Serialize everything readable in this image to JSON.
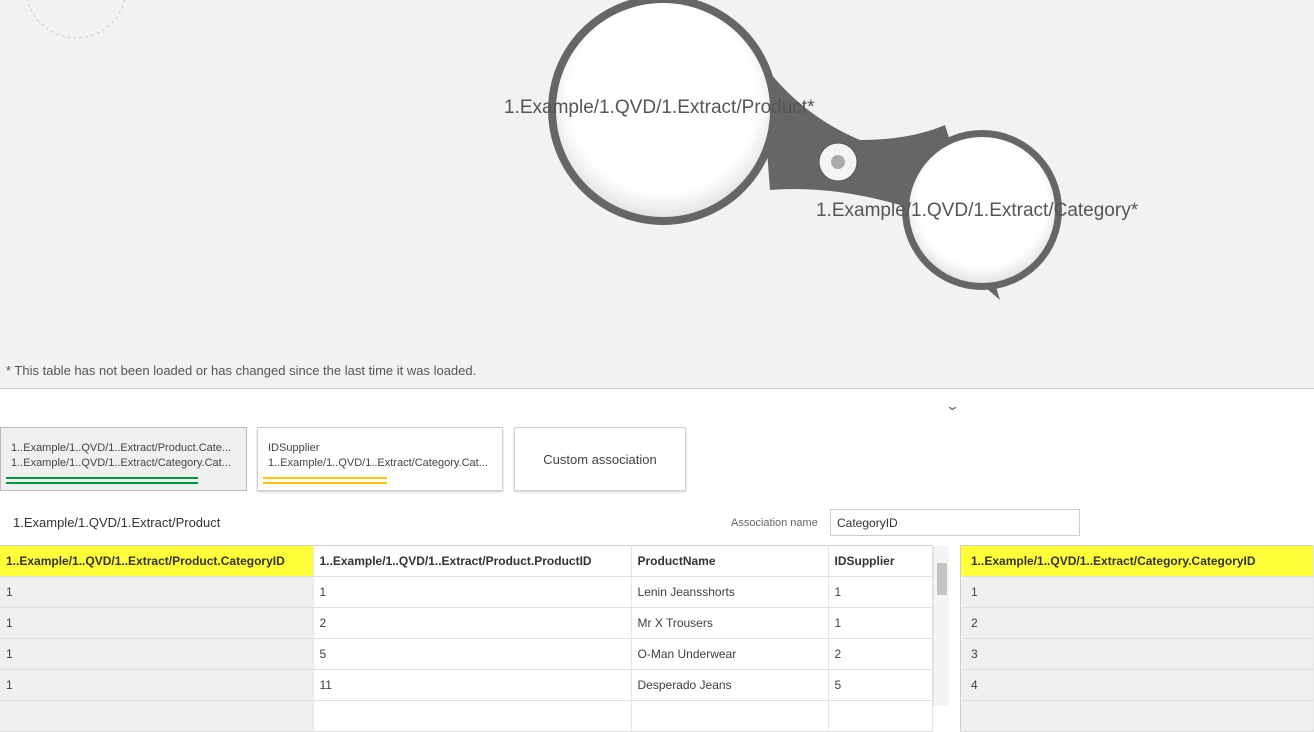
{
  "diagram": {
    "table1": "1.Example/1.QVD/1.Extract/Product*",
    "table2": "1.Example/1.QVD/1.Extract/Category*"
  },
  "note": "* This table has not been loaded or has changed since the last time it was loaded.",
  "cards": [
    {
      "line1": "1..Example/1..QVD/1..Extract/Product.Cate...",
      "line2": "1..Example/1..QVD/1..Extract/Category.Cat...",
      "color": "#009845"
    },
    {
      "line1": "IDSupplier",
      "line2": "1..Example/1..QVD/1..Extract/Category.Cat...",
      "color": "#ffc107"
    },
    {
      "label": "Custom association"
    }
  ],
  "table_name": "1.Example/1.QVD/1.Extract/Product",
  "association": {
    "label": "Association name",
    "value": "CategoryID"
  },
  "left_table": {
    "headers": [
      "1..Example/1..QVD/1..Extract/Product.CategoryID",
      "1..Example/1..QVD/1..Extract/Product.ProductID",
      "ProductName",
      "IDSupplier"
    ],
    "rows": [
      [
        "1",
        "1",
        "Lenin Jeansshorts",
        "1"
      ],
      [
        "1",
        "2",
        "Mr X Trousers",
        "1"
      ],
      [
        "1",
        "5",
        "O-Man Underwear",
        "2"
      ],
      [
        "1",
        "11",
        "Desperado Jeans",
        "5"
      ]
    ]
  },
  "right_table": {
    "header": "1..Example/1..QVD/1..Extract/Category.CategoryID",
    "rows": [
      "1",
      "2",
      "3",
      "4"
    ]
  }
}
